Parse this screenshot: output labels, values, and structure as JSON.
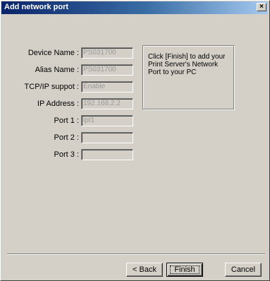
{
  "window": {
    "title": "Add network port",
    "close_glyph": "×"
  },
  "form": {
    "fields": [
      {
        "label": "Device Name :",
        "value": "PS031700"
      },
      {
        "label": "Alias Name :",
        "value": "PS031700"
      },
      {
        "label": "TCP/IP suppot :",
        "value": "Enable"
      },
      {
        "label": "IP Address :",
        "value": "192.168.2.2"
      },
      {
        "label": "Port 1 :",
        "value": "lpt1"
      },
      {
        "label": "Port 2 :",
        "value": ""
      },
      {
        "label": "Port 3 :",
        "value": ""
      }
    ]
  },
  "info": {
    "text": "Click [Finish] to add your Print Server's Network Port to your PC"
  },
  "buttons": {
    "back": "< Back",
    "finish": "Finish",
    "cancel": "Cancel"
  },
  "colors": {
    "title_start": "#0a246a",
    "title_end": "#a6caf0",
    "face": "#d4d0c8",
    "disabled_text": "#9a9a9a"
  }
}
